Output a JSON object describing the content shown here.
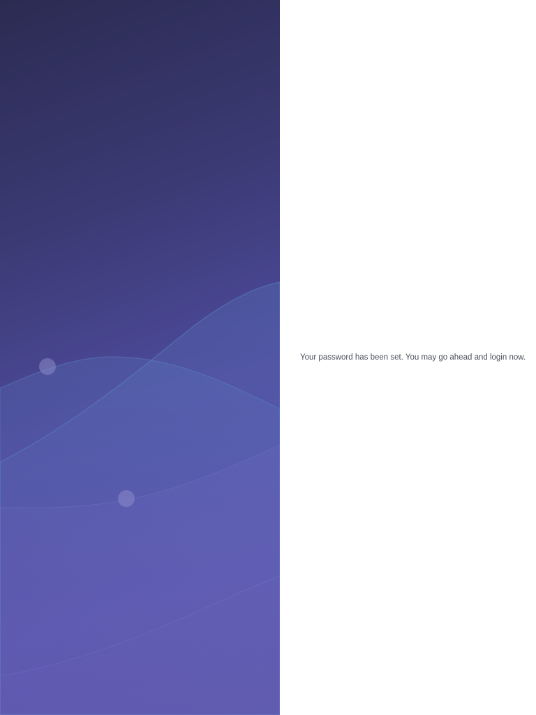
{
  "hero": {
    "background_colors": [
      "#2b2b52",
      "#3b3a74",
      "#4d4a9a",
      "#5b56ad"
    ],
    "wave_color": "#5b7fc4",
    "dot_color": "#8a8ac8"
  },
  "content": {
    "message": "Your password has been set. You may go ahead and login now."
  }
}
